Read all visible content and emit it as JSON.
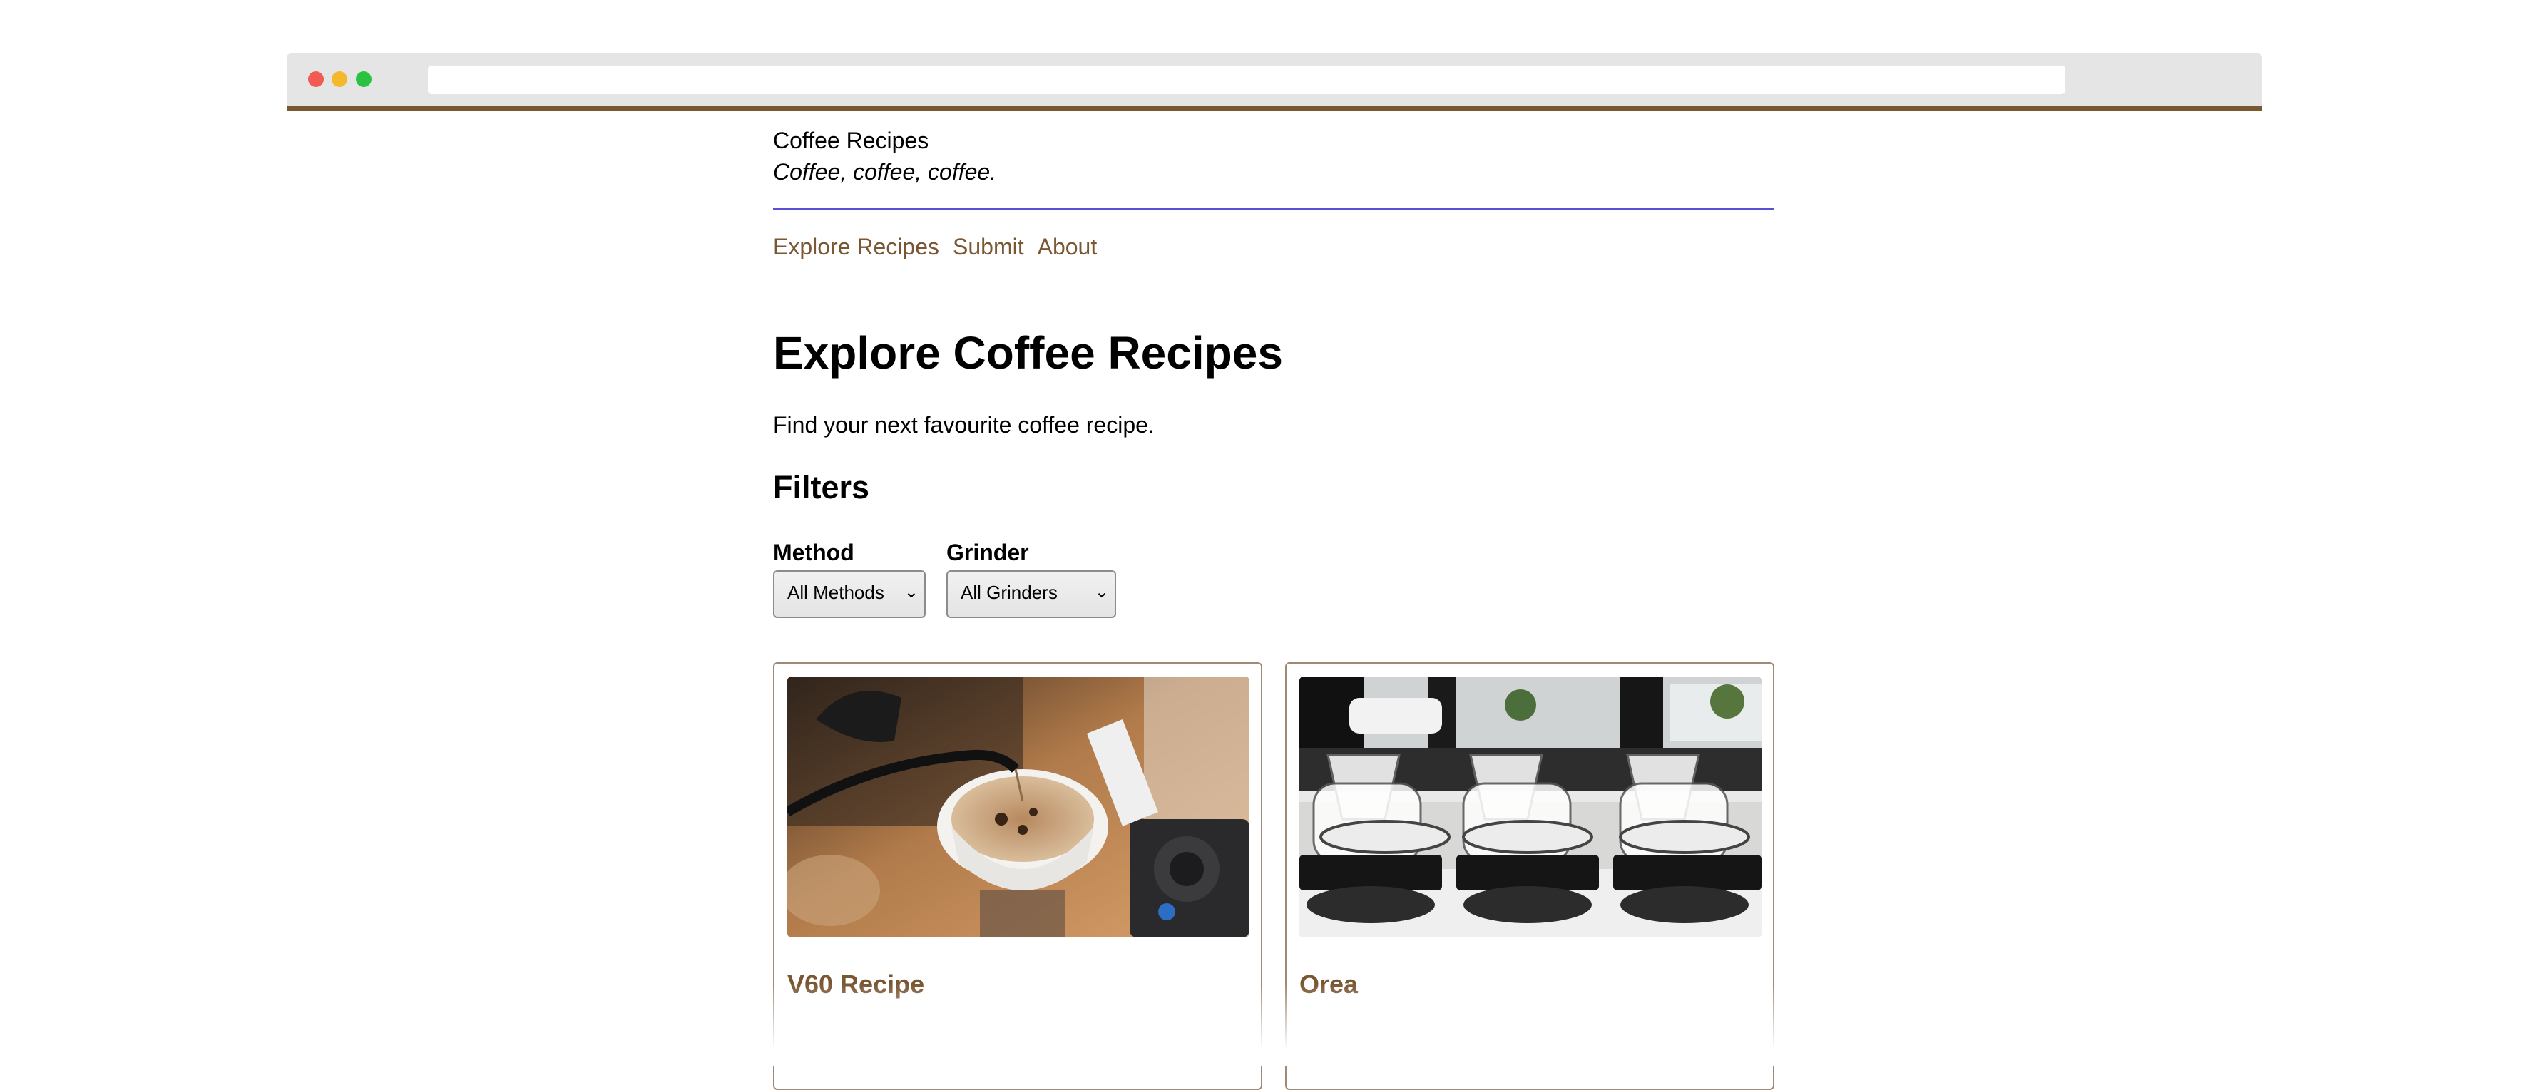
{
  "site": {
    "title": "Coffee Recipes",
    "tagline": "Coffee, coffee, coffee."
  },
  "nav": {
    "items": [
      {
        "label": "Explore Recipes"
      },
      {
        "label": "Submit"
      },
      {
        "label": "About"
      }
    ]
  },
  "main": {
    "heading": "Explore Coffee Recipes",
    "lead": "Find your next favourite coffee recipe.",
    "filters_heading": "Filters",
    "filters": {
      "method": {
        "label": "Method",
        "selected": "All Methods"
      },
      "grinder": {
        "label": "Grinder",
        "selected": "All Grinders"
      }
    },
    "cards": [
      {
        "title": "V60 Recipe",
        "image": "v60-pour-over-photo"
      },
      {
        "title": "Orea",
        "image": "glass-drippers-photo"
      }
    ]
  },
  "colors": {
    "accent": "#7a5733",
    "header_rule": "#5b4fd8",
    "card_border": "#a08a76"
  },
  "icons": {
    "select_chevron": "chevron-down-icon"
  }
}
